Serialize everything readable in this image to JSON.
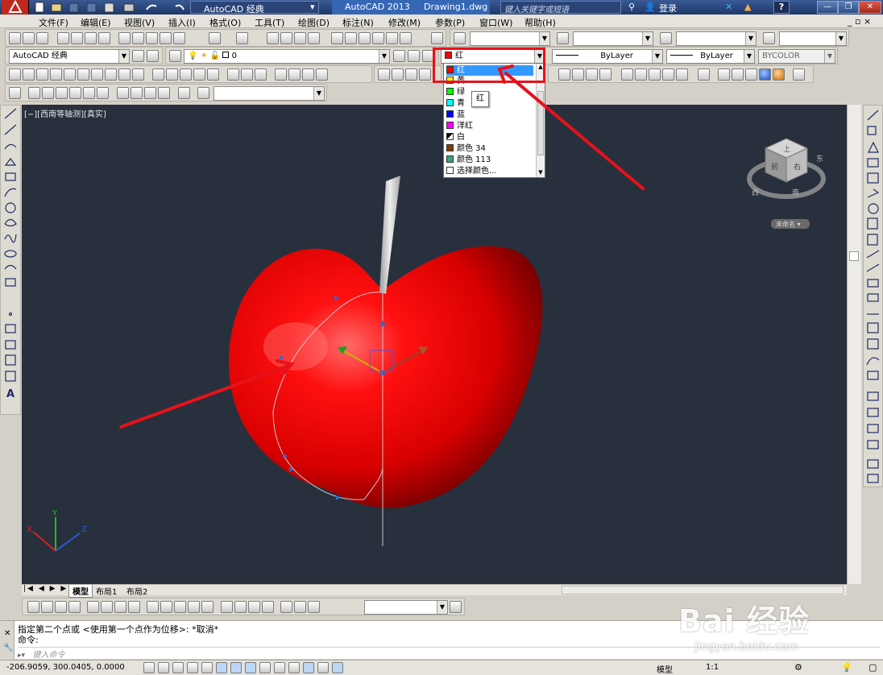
{
  "titlebar": {
    "workspace": "AutoCAD 经典",
    "app_name": "AutoCAD 2013",
    "file_name": "Drawing1.dwg",
    "search_placeholder": "键入关键字或短语",
    "login": "登录",
    "close_symbol": "✕",
    "minimize_symbol": "—",
    "restore_symbol": "❐",
    "help_symbol": "?"
  },
  "menubar": {
    "items": [
      "文件(F)",
      "编辑(E)",
      "视图(V)",
      "插入(I)",
      "格式(O)",
      "工具(T)",
      "绘图(D)",
      "标注(N)",
      "修改(M)",
      "参数(P)",
      "窗口(W)",
      "帮助(H)"
    ],
    "doc_controls": "_ ▫ ×"
  },
  "toolbar_properties": {
    "workspace_dropdown": "AutoCAD 经典",
    "layer_dropdown": "0",
    "color_dropdown": "红",
    "linetype_dropdown": "ByLayer",
    "lineweight_dropdown": "ByLayer",
    "plotstyle_dropdown": "BYCOLOR"
  },
  "color_list": {
    "items": [
      {
        "label": "红",
        "color": "#ff0000",
        "selected": true
      },
      {
        "label": "黄",
        "color": "#ffff00"
      },
      {
        "label": "绿",
        "color": "#00ff00"
      },
      {
        "label": "青",
        "color": "#00ffff"
      },
      {
        "label": "蓝",
        "color": "#0000ff"
      },
      {
        "label": "洋红",
        "color": "#ff00ff"
      },
      {
        "label": "白",
        "color": "#ffffff"
      },
      {
        "label": "颜色 34",
        "color": "#7f3f00"
      },
      {
        "label": "颜色 113",
        "color": "#3f9f7f"
      },
      {
        "label": "选择颜色...",
        "color": "#ffffff"
      }
    ],
    "tooltip": "红"
  },
  "viewport": {
    "label": "[−][西南等轴测][真实]",
    "background": "#28303d",
    "viewcube": {
      "top": "上",
      "front": "前",
      "right": "右",
      "west": "西",
      "south": "南",
      "east": "东",
      "ucs_label": "未命名 ▾"
    }
  },
  "layout_tabs": {
    "tabs": [
      "模型",
      "布局1",
      "布局2"
    ],
    "active": "模型"
  },
  "command": {
    "history_line": "指定第二个点或 <使用第一个点作为位移>: *取消*",
    "prompt_line": "命令:",
    "input_placeholder": "键入命令"
  },
  "statusbar": {
    "coordinates": "-206.9059, 300.0405, 0.0000",
    "model_label": "模型",
    "scale": "1:1"
  },
  "watermark": {
    "brand": "Bai 经验",
    "url": "jingyan.baidu.com"
  },
  "colors": {
    "apple_red": "#e00000",
    "highlight_red": "#e8111a",
    "viewport_bg": "#28303d"
  }
}
